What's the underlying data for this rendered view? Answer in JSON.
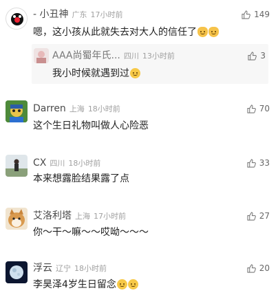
{
  "comments": [
    {
      "name": "- 小丑神",
      "location": "广东",
      "time": "17小时前",
      "likes": "149",
      "text": "嗯，这小孩从此就失去对大人的信任了",
      "emoji": [
        "cat-face-icon",
        "cat-face-icon"
      ],
      "reply": {
        "name": "AAA尚蜀年氏...",
        "location": "四川",
        "time": "13小时前",
        "likes": "3",
        "text": "我小时候就遇到过",
        "emoji": [
          "smile-face-icon"
        ]
      }
    },
    {
      "name": "Darren",
      "location": "上海",
      "time": "18小时前",
      "likes": "70",
      "text": "这个生日礼物叫做人心险恶"
    },
    {
      "name": "CX",
      "location": "四川",
      "time": "18小时前",
      "likes": "33",
      "text": "本来想露脸结果露了点"
    },
    {
      "name": "艾洛利塔",
      "location": "上海",
      "time": "17小时前",
      "likes": "27",
      "text": "你～干～嘛～～哎呦～～～"
    },
    {
      "name": "浮云",
      "location": "辽宁",
      "time": "18小时前",
      "likes": "20",
      "text": "李昊泽4岁生日留念",
      "emoji": [
        "thinking-face-icon",
        "thinking-face-icon"
      ]
    }
  ],
  "colors": {
    "meta": "#a0a0a0",
    "name": "#4a4a4a",
    "reply_bg": "#f7f7f7"
  }
}
